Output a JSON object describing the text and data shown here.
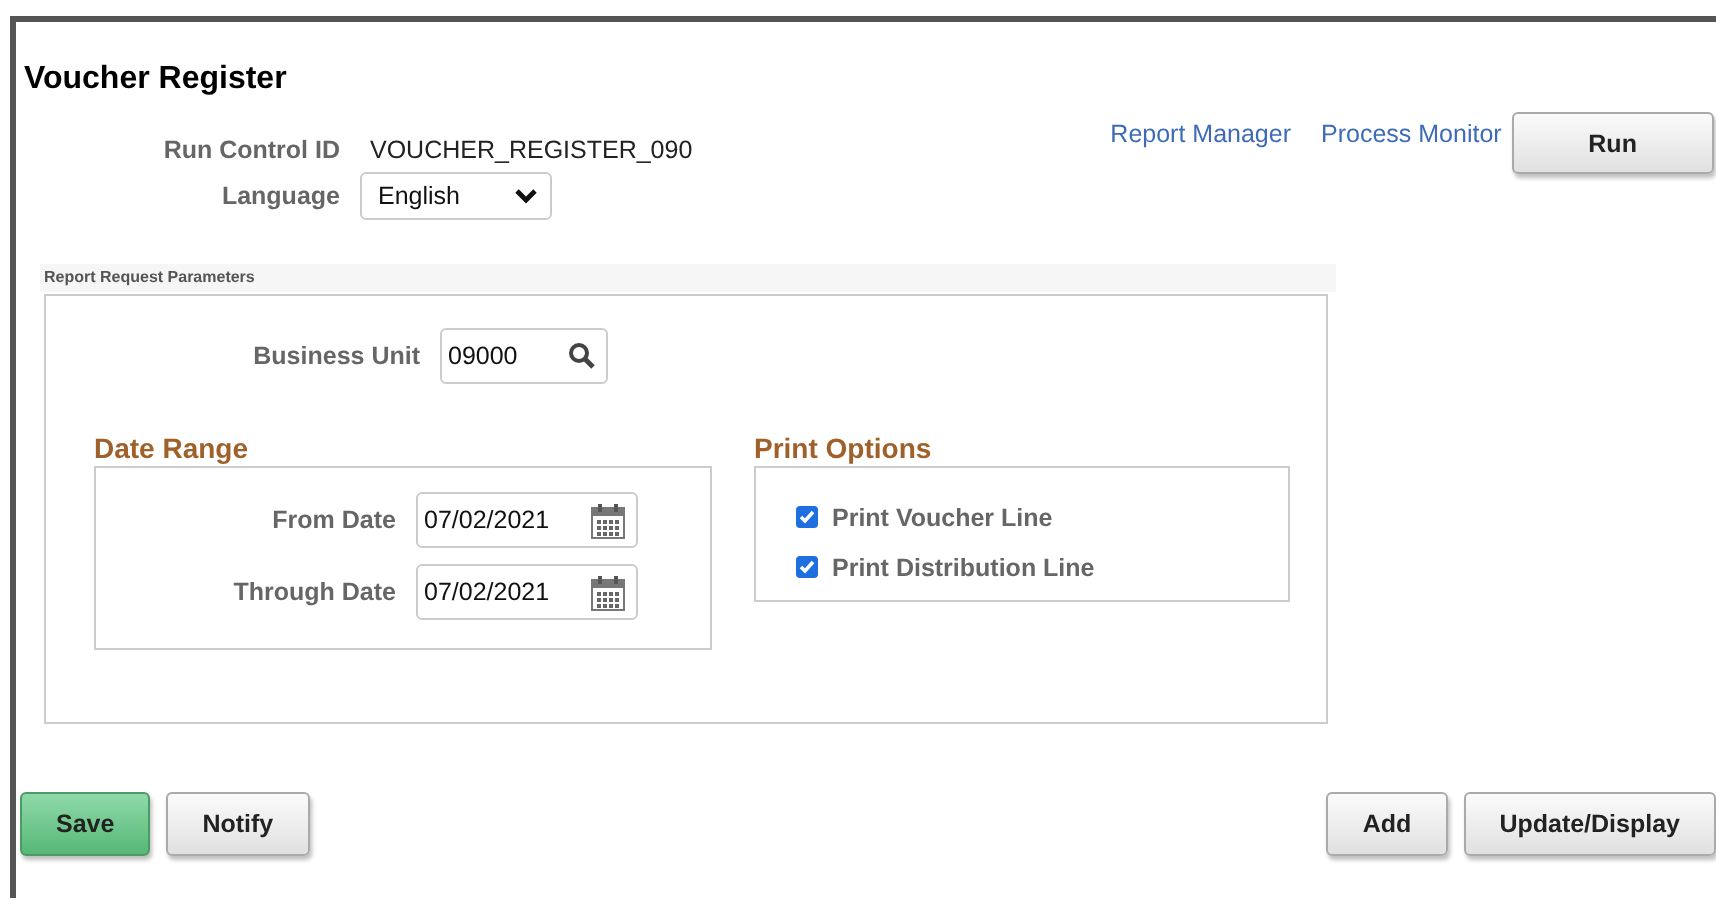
{
  "page_title": "Voucher Register",
  "run_control": {
    "label": "Run Control ID",
    "value": "VOUCHER_REGISTER_090"
  },
  "language": {
    "label": "Language",
    "value": "English"
  },
  "links": [
    "Report Manager",
    "Process Monitor"
  ],
  "run_button": "Run",
  "parameters": {
    "title": "Report Request Parameters",
    "business_unit": {
      "label": "Business Unit",
      "value": "09000"
    },
    "date_range": {
      "title": "Date Range",
      "fields": [
        {
          "label": "From Date",
          "value": "07/02/2021"
        },
        {
          "label": "Through Date",
          "value": "07/02/2021"
        }
      ]
    },
    "print_options": {
      "title": "Print Options",
      "options": [
        {
          "label": "Print Voucher Line",
          "checked": true
        },
        {
          "label": "Print Distribution Line",
          "checked": true
        }
      ]
    }
  },
  "left_buttons": [
    {
      "label": "Save",
      "kind": "primary"
    },
    {
      "label": "Notify",
      "kind": "plain"
    }
  ],
  "right_buttons": [
    {
      "label": "Add",
      "kind": "plain"
    },
    {
      "label": "Update/Display",
      "kind": "plain"
    }
  ]
}
